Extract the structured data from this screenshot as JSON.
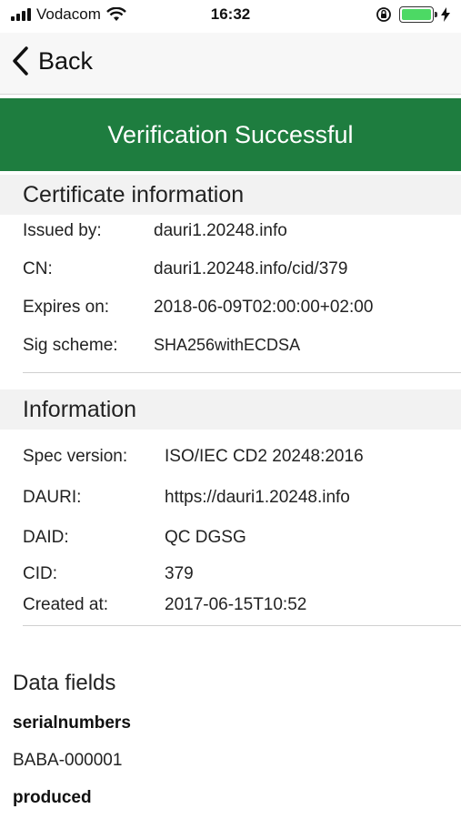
{
  "status_bar": {
    "carrier": "Vodacom",
    "time": "16:32",
    "battery_level": 1.0,
    "battery_color": "#4cd964"
  },
  "nav": {
    "back_label": "Back"
  },
  "banner": {
    "title": "Verification Successful",
    "color": "#1e7d3f"
  },
  "certificate": {
    "title": "Certificate information",
    "rows": [
      {
        "label": "Issued by:",
        "value": "dauri1.20248.info"
      },
      {
        "label": "CN:",
        "value": "dauri1.20248.info/cid/379"
      },
      {
        "label": "Expires on:",
        "value": "2018-06-09T02:00:00+02:00"
      },
      {
        "label": "Sig scheme:",
        "value": "SHA256withECDSA"
      }
    ]
  },
  "information": {
    "title": "Information",
    "rows": [
      {
        "label": "Spec version:",
        "value": "ISO/IEC CD2 20248:2016"
      },
      {
        "label": "DAURI:",
        "value": "https://dauri1.20248.info"
      },
      {
        "label": "DAID:",
        "value": "QC DGSG"
      },
      {
        "label": "CID:",
        "value": "379"
      },
      {
        "label": "Created at:",
        "value": "2017-06-15T10:52"
      }
    ]
  },
  "data_fields": {
    "title": "Data fields",
    "fields": [
      {
        "label": "serialnumbers",
        "value": "BABA-000001"
      },
      {
        "label": "produced",
        "value": ""
      }
    ]
  }
}
